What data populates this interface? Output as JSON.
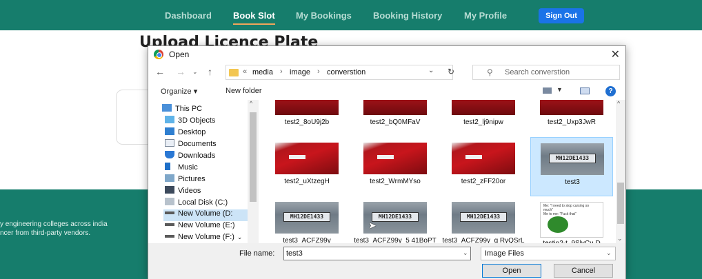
{
  "nav": {
    "items": [
      "Dashboard",
      "Book Slot",
      "My Bookings",
      "Booking History",
      "My Profile"
    ],
    "sign_out": "Sign Out"
  },
  "page": {
    "title": "Upload Licence Plate",
    "footer_line1": "y engineering colleges across india",
    "footer_line2": "ncer from third-party vendors."
  },
  "dialog": {
    "title": "Open",
    "close": "✕",
    "breadcrumb": [
      "«",
      "media",
      "›",
      "image",
      "›",
      "converstion"
    ],
    "search_placeholder": "Search converstion",
    "organize": "Organize ▾",
    "new_folder": "New folder",
    "tree": [
      "This PC",
      "3D Objects",
      "Desktop",
      "Documents",
      "Downloads",
      "Music",
      "Pictures",
      "Videos",
      "Local Disk (C:)",
      "New Volume (D:",
      "New Volume (E:)",
      "New Volume (F:)"
    ],
    "files": [
      {
        "name": "test2_8oU9j2b",
        "kind": "car-top"
      },
      {
        "name": "test2_bQ0MFaV",
        "kind": "car-top"
      },
      {
        "name": "test2_lj9nipw",
        "kind": "car-top"
      },
      {
        "name": "test2_Uxp3JwR",
        "kind": "car-top"
      },
      {
        "name": "test2_uXtzegH",
        "kind": "car"
      },
      {
        "name": "test2_WrmMYso",
        "kind": "car"
      },
      {
        "name": "test2_zFF20or",
        "kind": "car"
      },
      {
        "name": "test3",
        "kind": "plate",
        "selected": true
      },
      {
        "name": "test3_ACFZ99y",
        "kind": "plate"
      },
      {
        "name": "test3_ACFZ99y_5 41BoPT",
        "kind": "plate"
      },
      {
        "name": "test3_ACFZ99y_g RyQSrL",
        "kind": "plate"
      },
      {
        "name": "testin2-t_9SlvCu D",
        "kind": "meme"
      }
    ],
    "plate_text": "MH12DE1433",
    "meme_lines": [
      "Me: \"I need to stop cursing so",
      "much\"",
      "Me to me: \"Fuck that\""
    ],
    "file_name_label": "File name:",
    "file_name_value": "test3",
    "file_type": "Image Files",
    "open_button": "Open",
    "cancel_button": "Cancel"
  }
}
